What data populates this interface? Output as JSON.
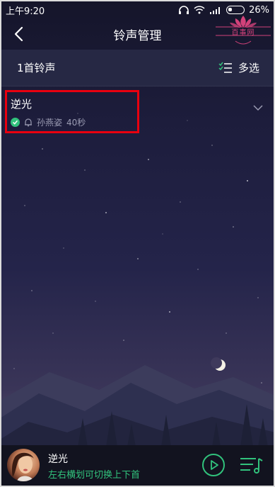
{
  "status_bar": {
    "time": "上午9:20",
    "battery": "26%",
    "battery_level": 0.26
  },
  "header": {
    "title": "铃声管理"
  },
  "watermark": {
    "text": "百事网"
  },
  "ring_list": {
    "count_label": "1首铃声",
    "multi_select_label": "多选",
    "items": [
      {
        "name": "逆光",
        "artist": "孙燕姿",
        "duration": "40秒"
      }
    ]
  },
  "player": {
    "song_title": "逆光",
    "hint": "左右横划可切换上下首"
  },
  "colors": {
    "accent": "#31c27c",
    "highlight": "#e8000f",
    "watermark": "#d2427a"
  },
  "icons": {
    "back": "chevron-left-icon",
    "headphones": "headphones-icon",
    "wifi": "wifi-icon",
    "signal": "signal-icon",
    "battery": "battery-icon",
    "multi_select": "checklist-icon",
    "check": "check-circle-icon",
    "bell": "bell-icon",
    "expand": "chevron-down-icon",
    "play": "play-icon",
    "playlist": "playlist-icon"
  }
}
